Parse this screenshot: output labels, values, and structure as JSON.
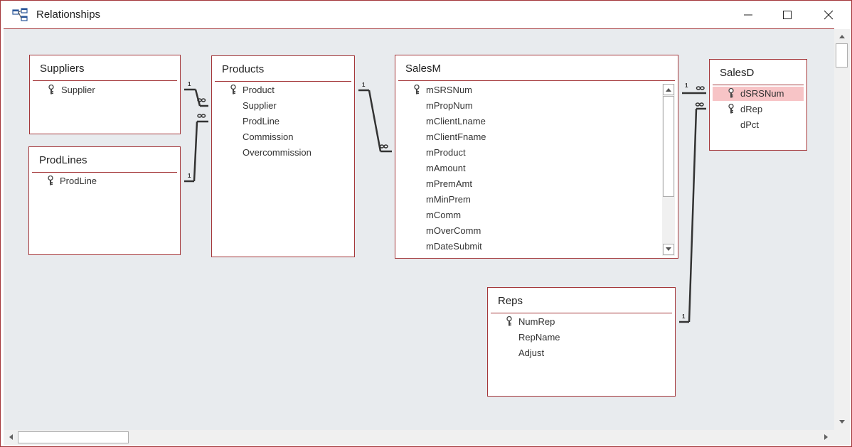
{
  "window": {
    "title": "Relationships",
    "icon": "relationships-icon",
    "controls": [
      "minimize-icon",
      "maximize-icon",
      "close-icon"
    ]
  },
  "tables": {
    "suppliers": {
      "title": "Suppliers",
      "fields": [
        "Supplier"
      ],
      "keys": [
        "Supplier"
      ]
    },
    "prodlines": {
      "title": "ProdLines",
      "fields": [
        "ProdLine"
      ],
      "keys": [
        "ProdLine"
      ]
    },
    "products": {
      "title": "Products",
      "fields": [
        "Product",
        "Supplier",
        "ProdLine",
        "Commission",
        "Overcommission"
      ],
      "keys": [
        "Product"
      ]
    },
    "salesm": {
      "title": "SalesM",
      "fields": [
        "mSRSNum",
        "mPropNum",
        "mClientLname",
        "mClientFname",
        "mProduct",
        "mAmount",
        "mPremAmt",
        "mMinPrem",
        "mComm",
        "mOverComm",
        "mDateSubmit"
      ],
      "keys": [
        "mSRSNum"
      ]
    },
    "salesd": {
      "title": "SalesD",
      "fields": [
        "dSRSNum",
        "dRep",
        "dPct"
      ],
      "keys": [
        "dSRSNum",
        "dRep"
      ],
      "selected": "dSRSNum"
    },
    "reps": {
      "title": "Reps",
      "fields": [
        "NumRep",
        "RepName",
        "Adjust"
      ],
      "keys": [
        "NumRep"
      ]
    }
  },
  "relationships": {
    "one_label": "1",
    "many_label": "∞"
  },
  "colors": {
    "accent": "#a4373a",
    "canvas": "#e8ebee",
    "selected": "#f7c4c6",
    "line": "#333333"
  }
}
